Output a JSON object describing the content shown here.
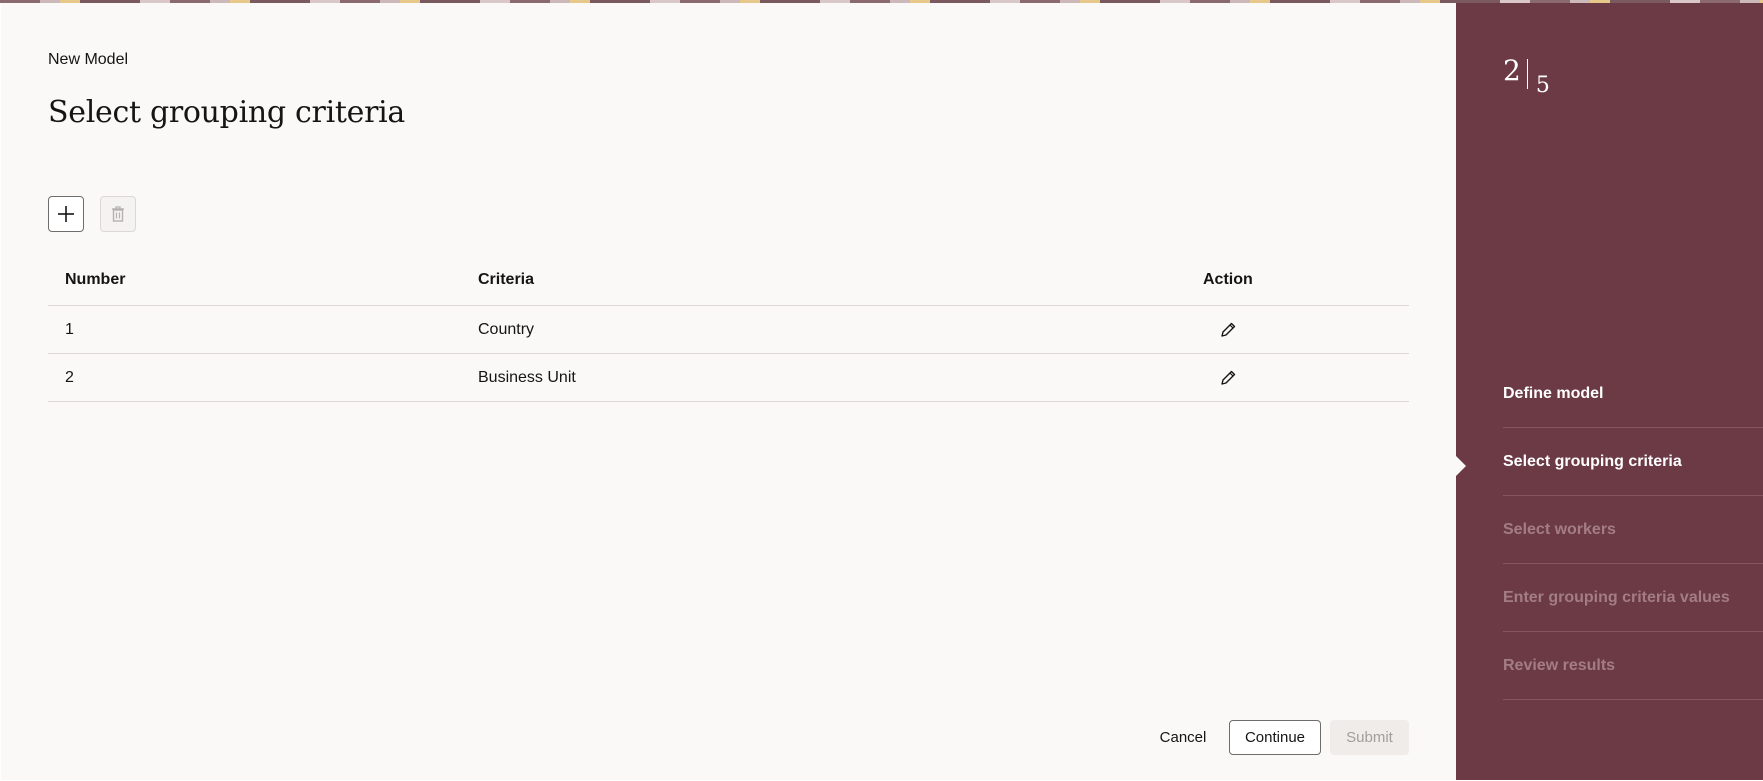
{
  "header": {
    "subtitle": "New Model",
    "title": "Select grouping criteria"
  },
  "toolbar": {
    "add_icon": "plus-icon",
    "delete_icon": "trash-icon"
  },
  "table": {
    "columns": [
      "Number",
      "Criteria",
      "Action"
    ],
    "rows": [
      {
        "number": "1",
        "criteria": "Country",
        "action_icon": "pencil-icon"
      },
      {
        "number": "2",
        "criteria": "Business Unit",
        "action_icon": "pencil-icon"
      }
    ]
  },
  "footer": {
    "cancel_label": "Cancel",
    "continue_label": "Continue",
    "submit_label": "Submit"
  },
  "progress": {
    "current": "2",
    "total": "5",
    "steps": [
      {
        "label": "Define model",
        "state": "done"
      },
      {
        "label": "Select grouping criteria",
        "state": "active"
      },
      {
        "label": "Select workers",
        "state": "future"
      },
      {
        "label": "Enter grouping criteria values",
        "state": "future"
      },
      {
        "label": "Review results",
        "state": "future"
      }
    ]
  },
  "colors": {
    "sidebar": "#6b3a44",
    "page_background": "#faf9f8",
    "future_step_text": "#a47d84"
  }
}
